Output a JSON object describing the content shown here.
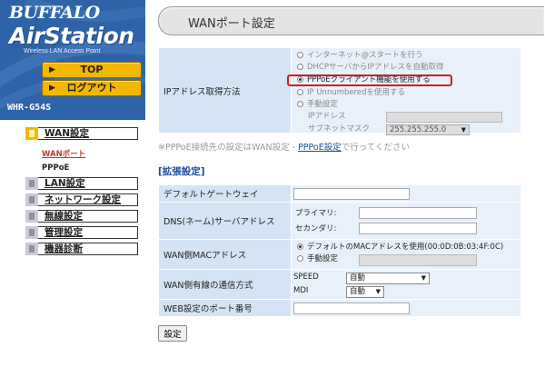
{
  "brand": {
    "logo": "BUFFALO",
    "product": "AirStation",
    "tagline": "Wireless LAN Access Point",
    "model": "WHR-G54S"
  },
  "topnav": {
    "top_label": "TOP",
    "logout_label": "ログアウト"
  },
  "sidebar": {
    "items": [
      {
        "label": "WAN設定",
        "active": true
      },
      {
        "label": "LAN設定"
      },
      {
        "label": "ネットワーク設定"
      },
      {
        "label": "無線設定"
      },
      {
        "label": "管理設定"
      },
      {
        "label": "機器診断"
      }
    ],
    "sub_items": [
      {
        "label": "WANポート",
        "active": true
      },
      {
        "label": "PPPoE"
      }
    ]
  },
  "header": {
    "title": "WANポート設定"
  },
  "ip_method": {
    "label": "IPアドレス取得方法",
    "options": [
      {
        "label": "インターネット@スタートを行う",
        "selected": false
      },
      {
        "label": "DHCPサーバからIPアドレスを自動取得",
        "selected": false
      },
      {
        "label": "PPPoEクライアント機能を使用する",
        "selected": true
      },
      {
        "label": "IP Unnumberedを使用する",
        "selected": false
      },
      {
        "label": "手動設定",
        "selected": false
      }
    ],
    "ip_address_label": "IPアドレス",
    "ip_address_value": "",
    "subnet_label": "サブネットマスク",
    "subnet_value": "255.255.255.0"
  },
  "note": {
    "text": "※PPPoE接続先の設定はWAN設定 - ",
    "link": "PPPoE設定",
    "suffix": "で行ってください"
  },
  "advanced": {
    "heading": "[拡張設定]",
    "default_gateway": {
      "label": "デフォルトゲートウェイ",
      "value": ""
    },
    "dns": {
      "label": "DNS(ネーム)サーバアドレス",
      "primary_label": "プライマリ:",
      "primary_value": "",
      "secondary_label": "セカンダリ:",
      "secondary_value": ""
    },
    "mac": {
      "label": "WAN側MACアドレス",
      "default_option": "デフォルトのMACアドレスを使用(00:0D:0B:03:4F:0C)",
      "manual_option": "手動設定",
      "manual_value": ""
    },
    "wired": {
      "label": "WAN側有線の通信方式",
      "speed_label": "SPEED",
      "speed_value": "自動",
      "mdi_label": "MDI",
      "mdi_value": "自動"
    },
    "web_port": {
      "label": "WEB設定のポート番号",
      "value": ""
    }
  },
  "apply_button": "設定",
  "colors": {
    "brand_blue": "#2e63a8",
    "button_yellow": "#f2b700",
    "label_cell": "#d4e4f5",
    "value_cell": "#e8f1fa",
    "highlight_red": "#cc1f1f",
    "link_blue": "#1a4d9a"
  }
}
